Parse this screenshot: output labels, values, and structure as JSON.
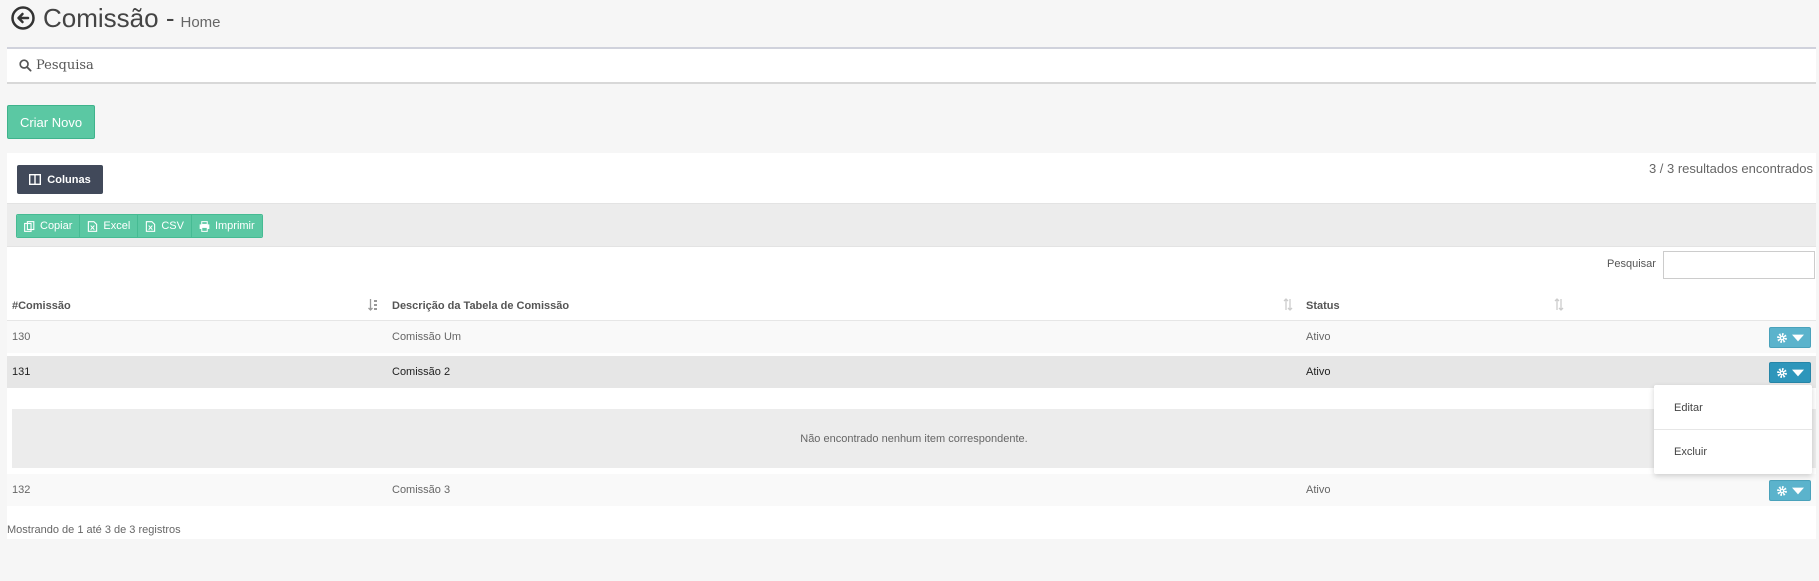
{
  "header": {
    "title": "Comissão -",
    "subtitle": "Home"
  },
  "search_panel": {
    "label": "Pesquisa"
  },
  "actions": {
    "create_label": "Criar Novo"
  },
  "table_controls": {
    "columns_label": "Colunas",
    "results_text": "3 / 3 resultados encontrados",
    "export_buttons": [
      "Copiar",
      "Excel",
      "CSV",
      "Imprimir"
    ],
    "search_label": "Pesquisar",
    "search_value": ""
  },
  "table": {
    "headers": [
      "#Comissão",
      "Descrição da Tabela de Comissão",
      "Status"
    ],
    "rows": [
      [
        "130",
        "Comissão Um",
        "Ativo"
      ],
      [
        "131",
        "Comissão 2",
        "Ativo"
      ],
      [
        "132",
        "Comissão 3",
        "Ativo"
      ]
    ],
    "empty_message": "Não encontrado nenhum item correspondente.",
    "footer": "Mostrando de 1 até 3 de 3 registros"
  },
  "dropdown": {
    "items": [
      "Editar",
      "Excluir"
    ]
  },
  "colors": {
    "accent_green": "#5bc8a3",
    "dark_button": "#41495a",
    "info_blue": "#5bb3cc"
  },
  "icons": [
    "back-circle-icon",
    "search-icon",
    "columns-icon",
    "copy-icon",
    "excel-icon",
    "csv-icon",
    "print-icon",
    "gear-icon",
    "caret-down-icon",
    "sort-icon"
  ]
}
